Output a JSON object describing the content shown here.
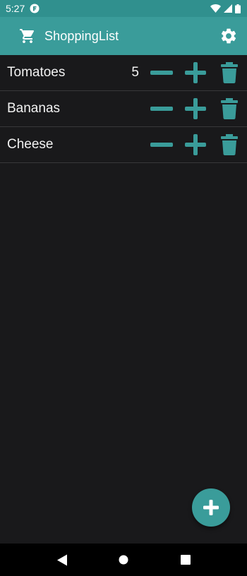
{
  "status_bar": {
    "time": "5:27",
    "icons": [
      "notification-app-icon",
      "wifi-icon",
      "cell-signal-icon",
      "battery-icon"
    ]
  },
  "app_bar": {
    "title": "ShoppingList",
    "icons": [
      "cart-icon",
      "gear-icon"
    ]
  },
  "colors": {
    "status_bar": "#30908e",
    "app_bar": "#3a9c9a",
    "accent": "#3a9c9a",
    "background": "#19191b",
    "divider": "#38383a"
  },
  "items": [
    {
      "name": "Tomatoes",
      "quantity": "5"
    },
    {
      "name": "Bananas",
      "quantity": ""
    },
    {
      "name": "Cheese",
      "quantity": ""
    }
  ],
  "row_icons": [
    "minus-icon",
    "plus-icon",
    "trash-icon"
  ],
  "fab": {
    "icon": "plus-icon"
  },
  "nav_bar": {
    "icons": [
      "back-icon",
      "home-icon",
      "recents-icon"
    ]
  }
}
